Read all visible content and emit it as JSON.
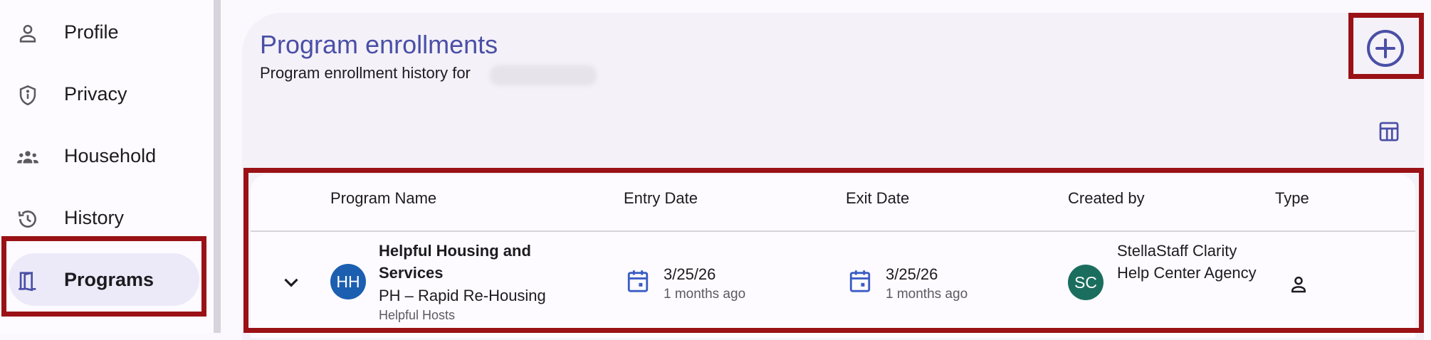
{
  "sidebar": {
    "items": [
      {
        "label": "Profile",
        "icon": "person-icon"
      },
      {
        "label": "Privacy",
        "icon": "shield-icon"
      },
      {
        "label": "Household",
        "icon": "group-icon"
      },
      {
        "label": "History",
        "icon": "history-icon"
      },
      {
        "label": "Programs",
        "icon": "door-icon",
        "active": true
      }
    ]
  },
  "main": {
    "title": "Program enrollments",
    "subtitle": "Program enrollment history for",
    "add_icon": "add-circle-icon",
    "columns_icon": "table-columns-icon"
  },
  "table": {
    "headers": [
      "Program Name",
      "Entry Date",
      "Exit Date",
      "Created by",
      "Type"
    ],
    "rows": [
      {
        "avatar": "HH",
        "program_name": "Helpful Housing and Services",
        "program_type": "PH – Rapid Re-Housing",
        "organization": "Helpful Hosts",
        "entry_date": "3/25/26",
        "entry_relative": "1 months ago",
        "exit_date": "3/25/26",
        "exit_relative": "1 months ago",
        "creator_avatar": "SC",
        "created_by": "StellaStaff Clarity Help Center Agency",
        "type_icon": "person-icon"
      }
    ]
  },
  "colors": {
    "accent": "#4a4fa6",
    "highlight": "#9a1116",
    "hh_avatar": "#1c5fb1",
    "sc_avatar": "#1b6e5e"
  }
}
